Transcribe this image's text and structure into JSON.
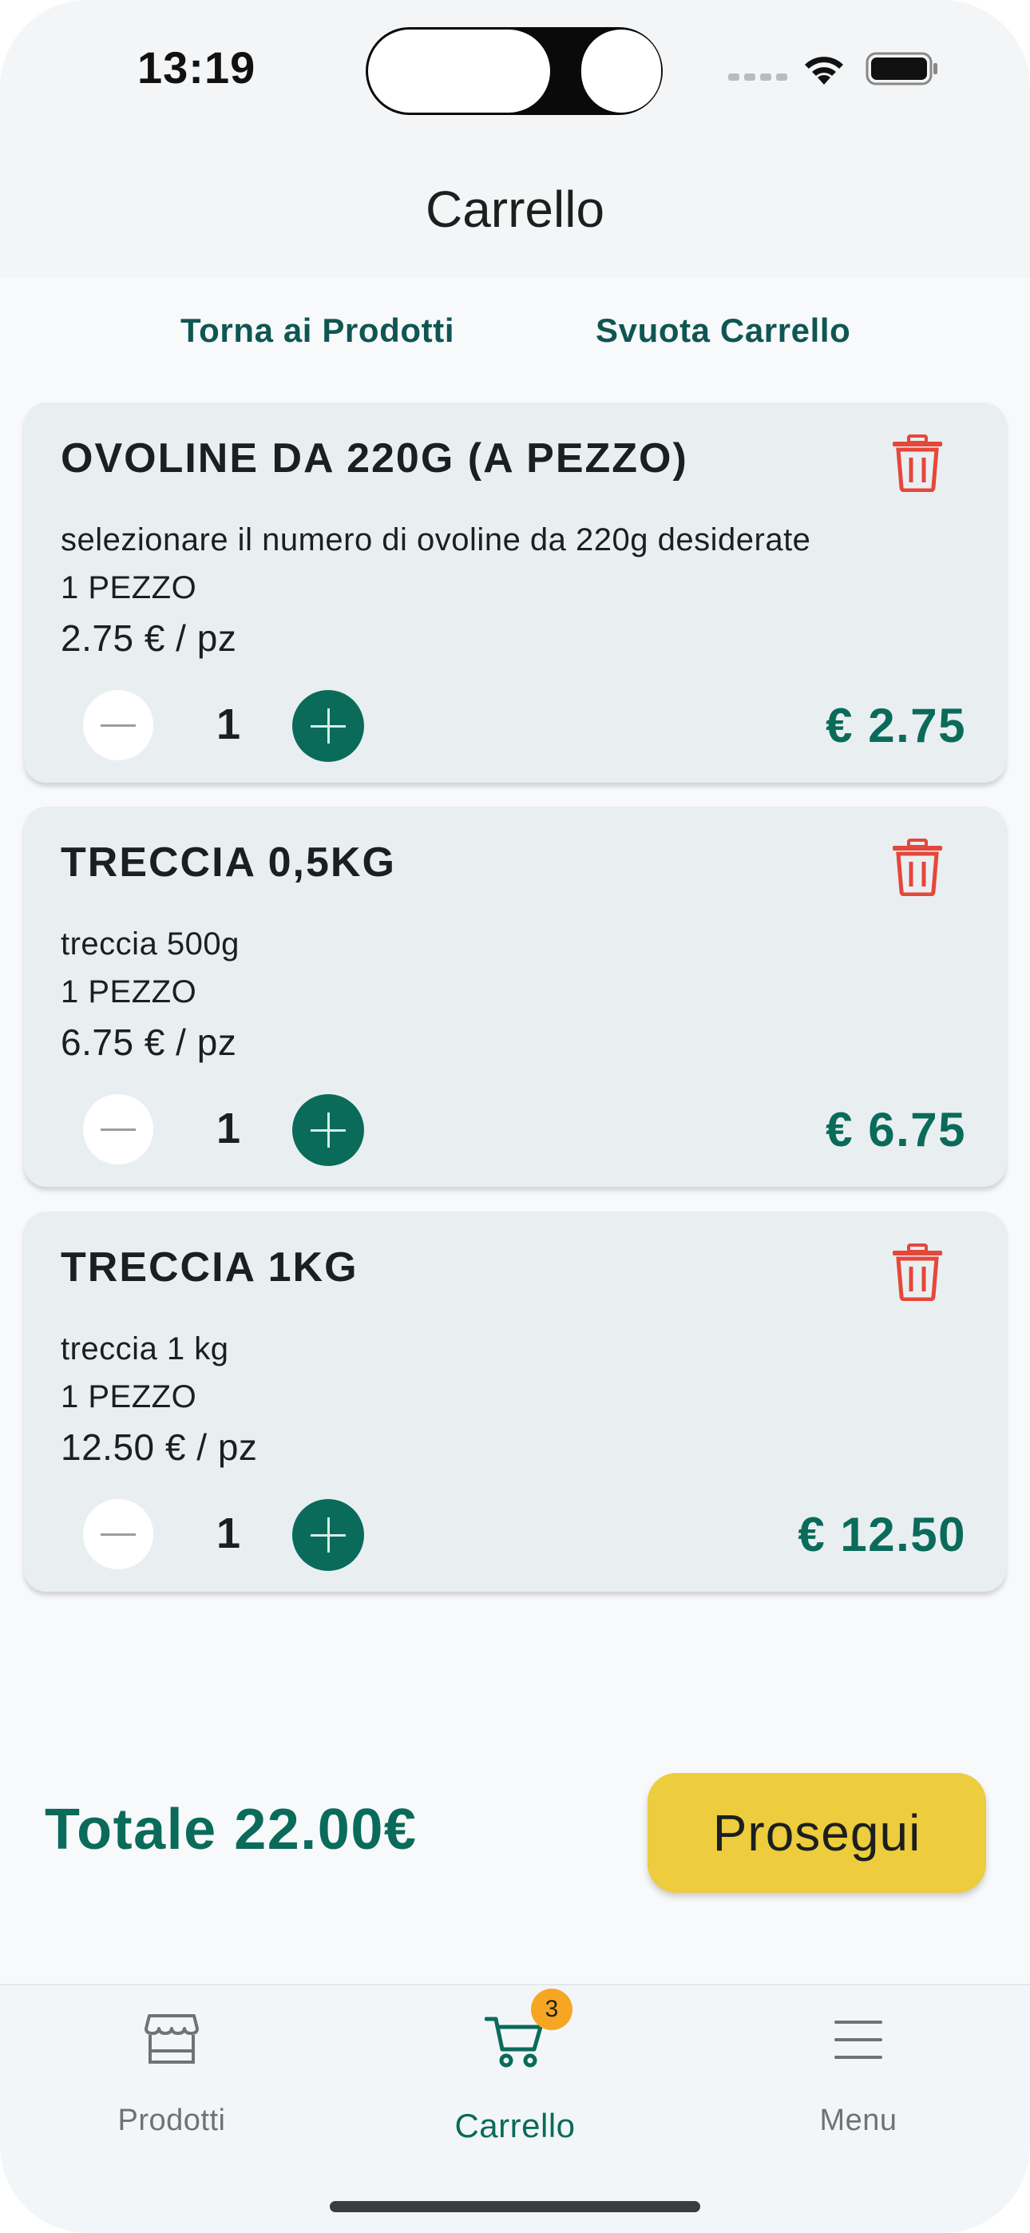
{
  "status_bar": {
    "time": "13:19"
  },
  "header": {
    "title": "Carrello"
  },
  "actions": {
    "back_label": "Torna ai Prodotti",
    "clear_label": "Svuota Carrello"
  },
  "cart_items": [
    {
      "name": "OVOLINE DA 220G (A PEZZO)",
      "description": "selezionare il numero di ovoline da 220g desiderate",
      "unit": "1 PEZZO",
      "unit_price": "2.75 € / pz",
      "quantity": "1",
      "line_total": "€ 2.75"
    },
    {
      "name": "TRECCIA 0,5KG",
      "description": "treccia 500g",
      "unit": "1 PEZZO",
      "unit_price": "6.75 € / pz",
      "quantity": "1",
      "line_total": "€ 6.75"
    },
    {
      "name": "TRECCIA 1KG",
      "description": "treccia 1 kg",
      "unit": "1 PEZZO",
      "unit_price": "12.50 € / pz",
      "quantity": "1",
      "line_total": "€ 12.50"
    }
  ],
  "summary": {
    "total_label": "Totale 22.00€",
    "proceed_label": "Prosegui"
  },
  "bottom_nav": {
    "items": [
      {
        "label": "Prodotti",
        "icon": "store-icon"
      },
      {
        "label": "Carrello",
        "icon": "cart-icon",
        "badge": "3"
      },
      {
        "label": "Menu",
        "icon": "menu-icon"
      }
    ]
  },
  "colors": {
    "accent": "#0a6b5a",
    "danger": "#e5473a",
    "cta": "#edcc3d",
    "badge": "#f6a623",
    "link": "#0f5653"
  }
}
